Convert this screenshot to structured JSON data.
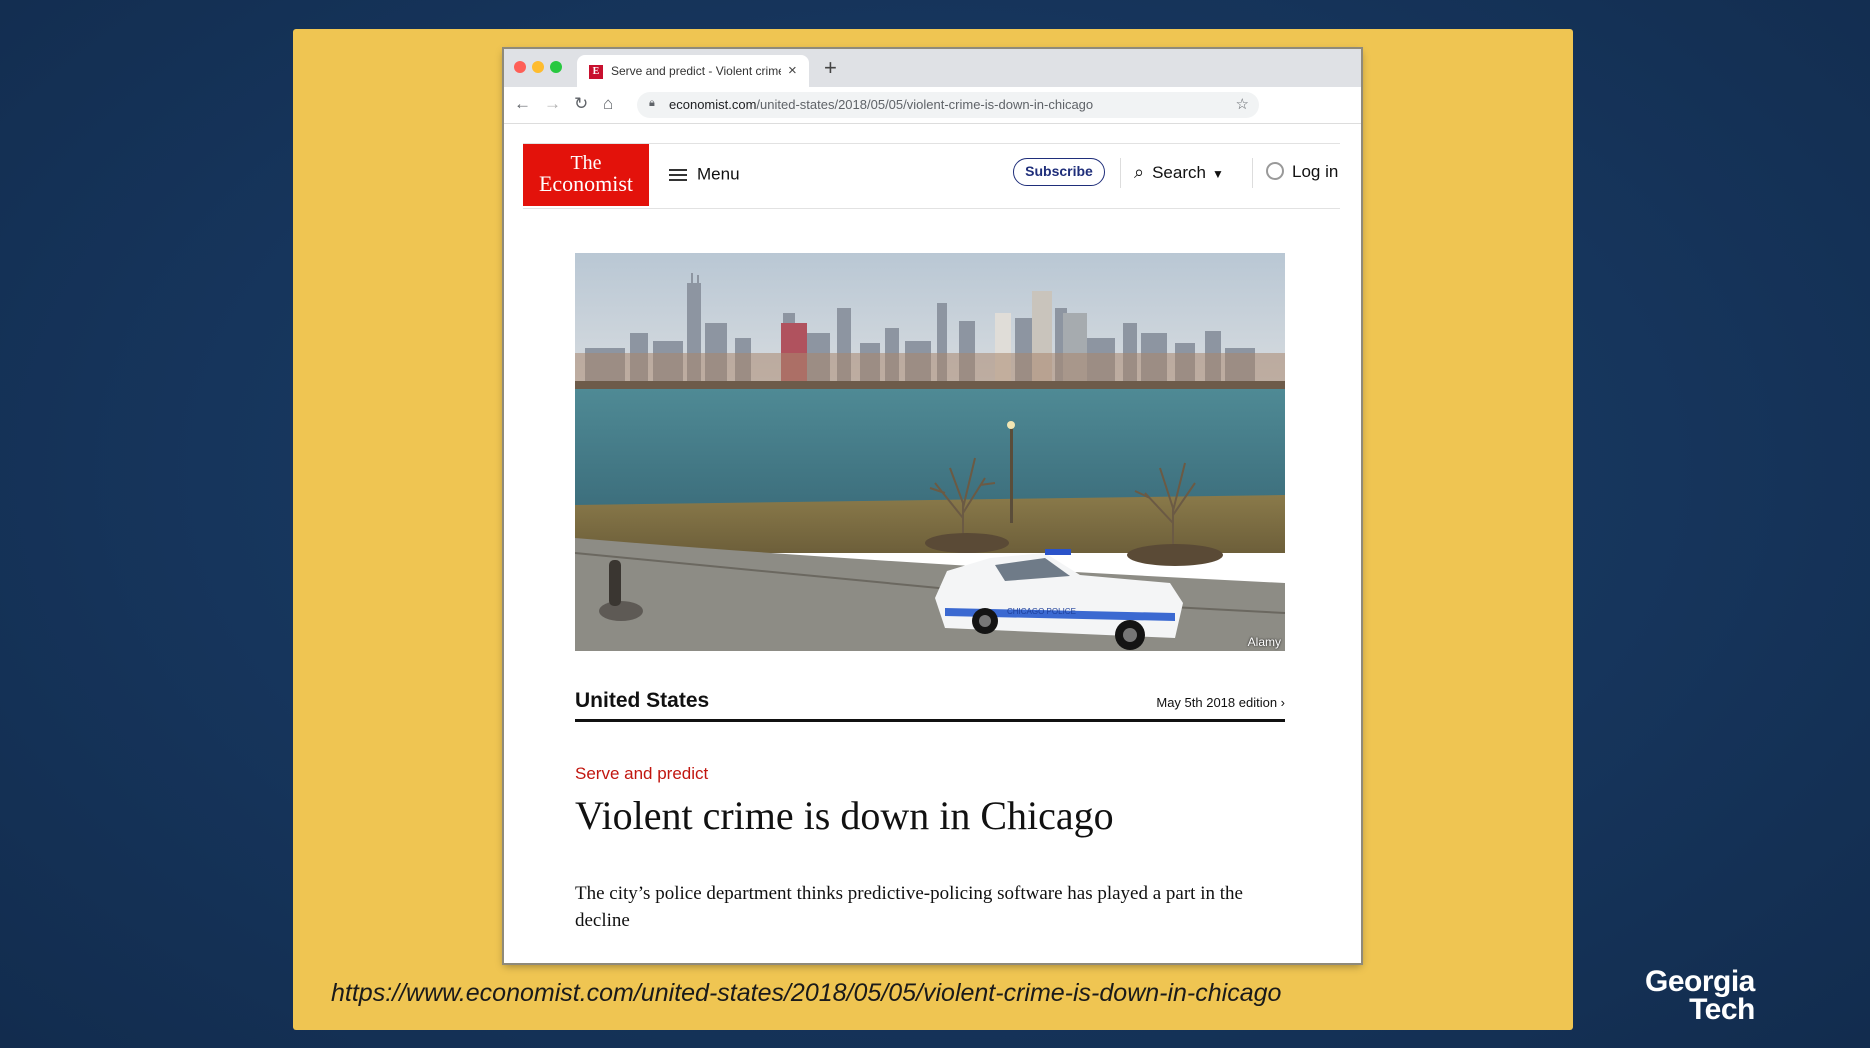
{
  "browser": {
    "tab_title": "Serve and predict - Violent crime is down in Chicago",
    "tab_favicon_letter": "E",
    "new_tab_glyph": "+",
    "close_glyph": "×",
    "url_domain": "economist.com",
    "url_path": "/united-states/2018/05/05/violent-crime-is-down-in-chicago"
  },
  "site_header": {
    "logo_line1": "The",
    "logo_line2": "Economist",
    "menu_label": "Menu",
    "subscribe_label": "Subscribe",
    "search_label": "Search",
    "login_label": "Log in"
  },
  "article": {
    "image_credit": "Alamy",
    "section": "United States",
    "edition": "May 5th 2018 edition ›",
    "flytitle": "Serve and predict",
    "headline": "Violent crime is down in Chicago",
    "rubric": "The city’s police department thinks predictive-policing software has played a part in the decline"
  },
  "slide": {
    "source_url": "https://www.economist.com/united-states/2018/05/05/violent-crime-is-down-in-chicago",
    "logo_line1": "Georgia",
    "logo_line2": "Tech"
  },
  "colors": {
    "slide_bg": "#efc552",
    "economist_red": "#e3120b",
    "flytitle_red": "#c1160f",
    "background_navy": "#16355c"
  },
  "icons": [
    "back-arrow-icon",
    "forward-arrow-icon",
    "reload-icon",
    "home-icon",
    "lock-icon",
    "star-icon",
    "hamburger-icon",
    "search-icon",
    "chevron-down-icon",
    "user-icon"
  ]
}
